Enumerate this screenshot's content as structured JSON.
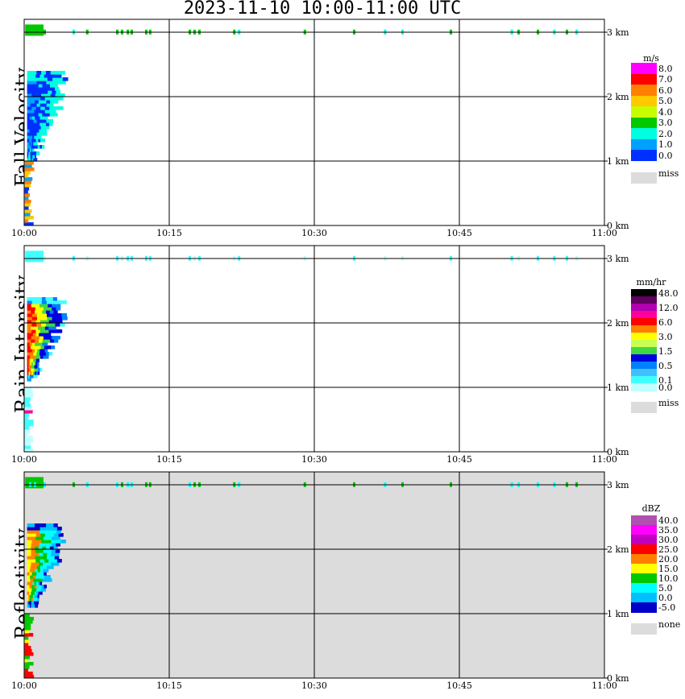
{
  "title": "2023-11-10   10:00-11:00 UTC",
  "chart_data": [
    {
      "type": "heatmap",
      "ylabel": "Fall Velocity",
      "legend_title": "m/s",
      "legend_levels": [
        "8.0",
        "7.0",
        "6.0",
        "5.0",
        "4.0",
        "3.0",
        "2.0",
        "1.0",
        "0.0"
      ],
      "legend_colors": [
        "#ff00ff",
        "#ff0000",
        "#ff8000",
        "#ffc800",
        "#c8ff00",
        "#00c800",
        "#00ffe0",
        "#00a0ff",
        "#0030ff"
      ],
      "missing_label": "miss",
      "background": "#ffffff",
      "x_ticks": [
        "10:00",
        "10:15",
        "10:30",
        "10:45",
        "11:00"
      ],
      "y_ticks": [
        "0 km",
        "1 km",
        "2 km",
        "3 km"
      ],
      "xlim": [
        "10:00",
        "11:00"
      ],
      "ylim_km": [
        0,
        3.2
      ],
      "grid": true,
      "main_echo": {
        "time_min": [
          0.3,
          4.5
        ],
        "alt_km": [
          1.0,
          2.35
        ],
        "colors": [
          "#00a0ff",
          "#0030ff",
          "#00ffe0"
        ]
      },
      "low_echo": {
        "alt_km": [
          0,
          1.0
        ],
        "colors": [
          "#ffc800",
          "#ff8000",
          "#00a0ff",
          "#0030ff"
        ]
      },
      "top_band": {
        "alt_km": 3.0,
        "colors": [
          "#00c800",
          "#00ffe0"
        ]
      }
    },
    {
      "type": "heatmap",
      "ylabel": "Rain Intensity",
      "legend_title": "mm/hr",
      "legend_levels": [
        "48.0",
        "",
        "12.0",
        "",
        "6.0",
        "",
        "3.0",
        "",
        "1.5",
        "",
        "0.5",
        "",
        "0.1",
        "0.0"
      ],
      "legend_colors": [
        "#000000",
        "#600060",
        "#b000b0",
        "#ff00a0",
        "#ff0000",
        "#ff8000",
        "#ffff00",
        "#c8ff50",
        "#40d840",
        "#0000e0",
        "#0080ff",
        "#40c0ff",
        "#40ffff",
        "#c0ffff"
      ],
      "missing_label": "miss",
      "background": "#ffffff",
      "x_ticks": [
        "10:00",
        "10:15",
        "10:30",
        "10:45",
        "11:00"
      ],
      "y_ticks": [
        "0 km",
        "1 km",
        "2 km",
        "3 km"
      ],
      "xlim": [
        "10:00",
        "11:00"
      ],
      "ylim_km": [
        0,
        3.2
      ],
      "grid": true,
      "main_echo": {
        "time_min": [
          0.3,
          4.5
        ],
        "alt_km": [
          1.1,
          2.35
        ],
        "colors": [
          "#ff0000",
          "#ff8000",
          "#ffff00",
          "#40d840",
          "#0000e0",
          "#0080ff",
          "#40ffff"
        ]
      },
      "low_echo": {
        "alt_km": [
          0,
          1.0
        ],
        "colors": [
          "#40ffff",
          "#c0ffff",
          "#ff00a0"
        ]
      },
      "top_band": {
        "alt_km": 3.0,
        "colors": [
          "#40ffff",
          "#c0ffff"
        ]
      }
    },
    {
      "type": "heatmap",
      "ylabel": "Reflectivity",
      "legend_title": "dBZ",
      "legend_levels": [
        "40.0",
        "35.0",
        "30.0",
        "25.0",
        "20.0",
        "15.0",
        "10.0",
        "5.0",
        "0.0",
        "-5.0"
      ],
      "legend_colors": [
        "#b050b0",
        "#ff00ff",
        "#c000c0",
        "#ff0000",
        "#ff8000",
        "#ffff00",
        "#00c800",
        "#00ffff",
        "#00c0ff",
        "#0000c8"
      ],
      "missing_label": "none",
      "background": "#dcdcdc",
      "x_ticks": [
        "10:00",
        "10:15",
        "10:30",
        "10:45",
        "11:00"
      ],
      "y_ticks": [
        "0 km",
        "1 km",
        "2 km",
        "3 km"
      ],
      "xlim": [
        "10:00",
        "11:00"
      ],
      "ylim_km": [
        0,
        3.2
      ],
      "grid": true,
      "main_echo": {
        "time_min": [
          0.3,
          4.5
        ],
        "alt_km": [
          1.1,
          2.35
        ],
        "colors": [
          "#ffff00",
          "#ff8000",
          "#00c800",
          "#00ffff",
          "#00c0ff",
          "#0000c8"
        ]
      },
      "low_echo": {
        "alt_km": [
          0,
          1.0
        ],
        "colors": [
          "#ffff00",
          "#00c800",
          "#ff0000"
        ]
      },
      "top_band": {
        "alt_km": 3.0,
        "colors": [
          "#00c800",
          "#00ffff"
        ]
      }
    }
  ]
}
